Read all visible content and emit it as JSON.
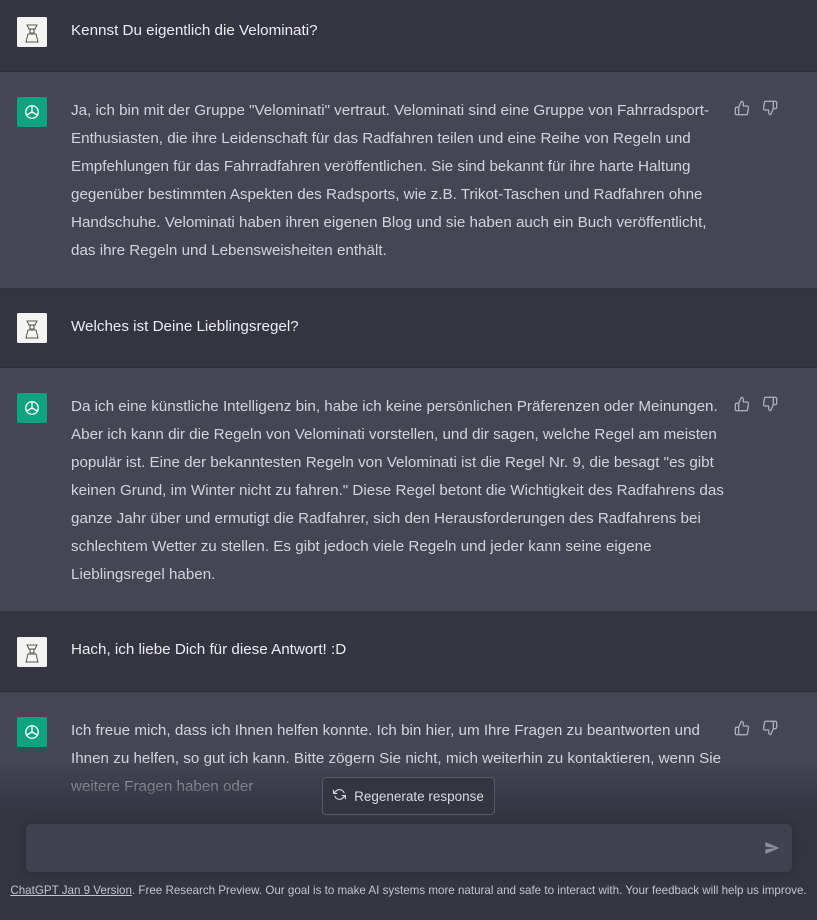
{
  "messages": [
    {
      "role": "user",
      "text": "Kennst Du eigentlich die Velominati?"
    },
    {
      "role": "assistant",
      "text": "Ja, ich bin mit der Gruppe \"Velominati\" vertraut. Velominati sind eine Gruppe von Fahrradsport-Enthusiasten, die ihre Leidenschaft für das Radfahren teilen und eine Reihe von Regeln und Empfehlungen für das Fahrradfahren veröffentlichen. Sie sind bekannt für ihre harte Haltung gegenüber bestimmten Aspekten des Radsports, wie z.B. Trikot-Taschen und Radfahren ohne Handschuhe. Velominati haben ihren eigenen Blog und sie haben auch ein Buch veröffentlicht, das ihre Regeln und Lebensweisheiten enthält."
    },
    {
      "role": "user",
      "text": "Welches ist Deine Lieblingsregel?"
    },
    {
      "role": "assistant",
      "text": "Da ich eine künstliche Intelligenz bin, habe ich keine persönlichen Präferenzen oder Meinungen. Aber ich kann dir die Regeln von Velominati vorstellen, und dir sagen, welche Regel am meisten populär ist. Eine der bekanntesten Regeln von Velominati ist die Regel Nr. 9, die besagt \"es gibt keinen Grund, im Winter nicht zu fahren.\" Diese Regel betont die Wichtigkeit des Radfahrens das ganze Jahr über und ermutigt die Radfahrer, sich den Herausforderungen des Radfahrens bei schlechtem Wetter zu stellen. Es gibt jedoch viele Regeln und jeder kann seine eigene Lieblingsregel haben."
    },
    {
      "role": "user",
      "text": "Hach, ich liebe Dich für diese Antwort! :D"
    },
    {
      "role": "assistant",
      "text": "Ich freue mich, dass ich Ihnen helfen konnte. Ich bin hier, um Ihre Fragen zu beantworten und Ihnen zu helfen, so gut ich kann. Bitte zögern Sie nicht, mich weiterhin zu kontaktieren, wenn Sie weitere Fragen haben oder"
    }
  ],
  "regenerate_label": "Regenerate response",
  "input": {
    "value": "",
    "placeholder": ""
  },
  "footer": {
    "link_text": "ChatGPT Jan 9 Version",
    "text": ". Free Research Preview. Our goal is to make AI systems more natural and safe to interact with. Your feedback will help us improve."
  },
  "colors": {
    "background": "#343541",
    "assistant_background": "#444654",
    "accent": "#10a37f",
    "input_background": "#40414f"
  },
  "icons": {
    "user_avatar": "user-avatar-icon",
    "assistant_avatar": "openai-logo-icon",
    "thumbs_up": "thumbs-up-icon",
    "thumbs_down": "thumbs-down-icon",
    "regenerate": "refresh-icon",
    "send": "send-icon"
  }
}
